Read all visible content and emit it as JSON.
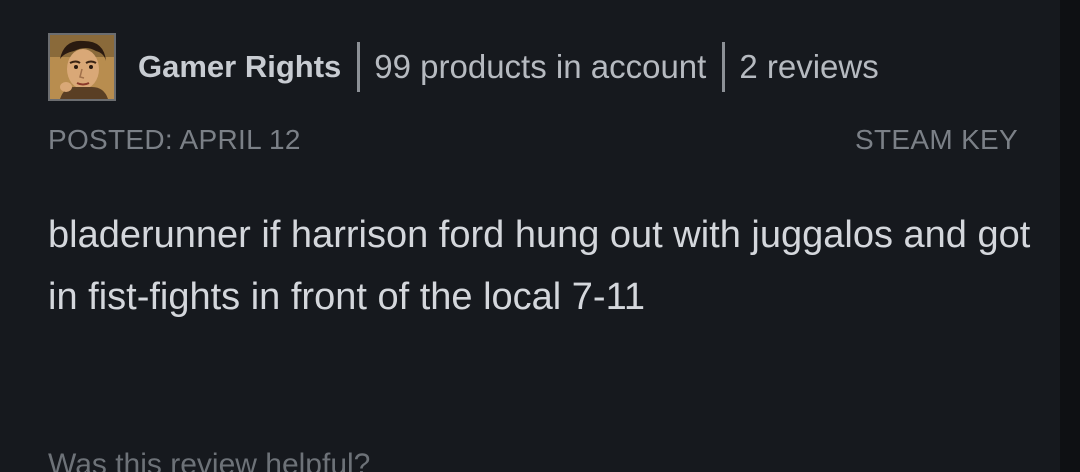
{
  "author": {
    "name": "Gamer Rights",
    "products": "99 products in account",
    "reviews": "2 reviews"
  },
  "post": {
    "posted": "POSTED: APRIL 12",
    "source": "STEAM KEY"
  },
  "review": {
    "text": "bladerunner if harrison ford hung out with juggalos and got in fist-fights in front of the local 7-11"
  },
  "footer": {
    "helpful_prompt": "Was this review helpful?"
  }
}
